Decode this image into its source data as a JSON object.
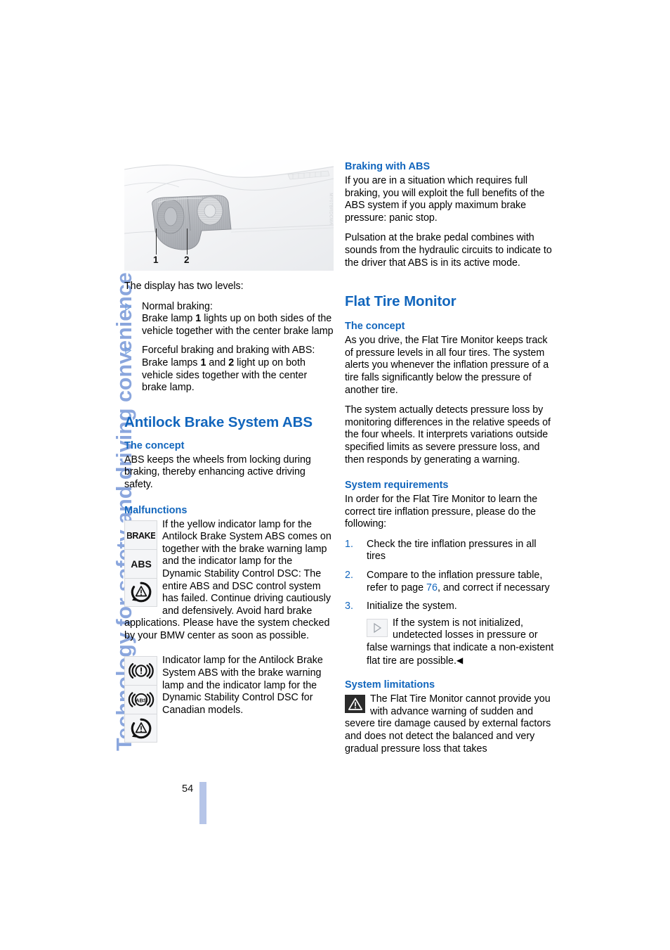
{
  "chapter": {
    "vertical_title": "Technology for safety and driving convenience"
  },
  "footer": {
    "page_number": "54"
  },
  "figure": {
    "caption_labels": [
      "1",
      "2"
    ],
    "watermark": "MY07BRDCMA"
  },
  "left_column": {
    "intro": "The display has two levels:",
    "bullets": [
      {
        "line1": "Normal braking:",
        "line2_pre": "Brake lamp ",
        "line2_bold": "1",
        "line2_post": " lights up on both sides of the vehicle together with the center brake lamp"
      },
      {
        "line1": "Forceful braking and braking with ABS:",
        "line2_pre": "Brake lamps ",
        "line2_bold": "1",
        "line2_mid": " and ",
        "line2_bold2": "2",
        "line2_post": " light up on both vehicle sides together with the center brake lamp."
      }
    ],
    "heading_abs": "Antilock Brake System ABS",
    "concept_heading": "The concept",
    "concept_text": "ABS keeps the wheels from locking during braking, thereby enhancing active driving safety.",
    "malfunctions_heading": "Malfunctions",
    "malfunctions_text": "If the yellow indicator lamp for the Antilock Brake System ABS comes on together with the brake warning lamp and the indicator lamp for the Dynamic Stability Control DSC: The entire ABS and DSC control system has failed. Continue driving cautiously and defensively. Avoid hard brake applications. Please have the system checked by your BMW center as soon as possible.",
    "malfunction_icons": [
      "brake-text-icon",
      "abs-text-icon",
      "dsc-triangle-icon"
    ],
    "canadian_text": "Indicator lamp for the Antilock Brake System ABS with the brake warning lamp and the indicator lamp for the Dynamic Stability Control DSC for Canadian models.",
    "canadian_icons": [
      "brake-circle-exclamation-icon",
      "abs-circle-icon",
      "dsc-triangle-icon"
    ]
  },
  "right_column": {
    "braking_heading": "Braking with ABS",
    "braking_p1": "If you are in a situation which requires full braking, you will exploit the full benefits of the ABS system if you apply maximum brake pressure: panic stop.",
    "braking_p2": "Pulsation at the brake pedal combines with sounds from the hydraulic circuits to indicate to the driver that ABS is in its active mode.",
    "flat_tire_heading": "Flat Tire Monitor",
    "concept_heading": "The concept",
    "concept_p1": "As you drive, the Flat Tire Monitor keeps track of pressure levels in all four tires. The system alerts you whenever the inflation pressure of a tire falls significantly below the pressure of another tire.",
    "concept_p2": "The system actually detects pressure loss by monitoring differences in the relative speeds of the four wheels. It interprets variations outside specified limits as severe pressure loss, and then responds by generating a warning.",
    "requirements_heading": "System requirements",
    "requirements_intro": "In order for the Flat Tire Monitor to learn the correct tire inflation pressure, please do the following:",
    "steps": [
      {
        "num": "1.",
        "text": "Check the tire inflation pressures in all tires"
      },
      {
        "num": "2.",
        "pre": "Compare to the inflation pressure table, refer to page ",
        "ref": "76",
        "post": ", and correct if necessary"
      },
      {
        "num": "3.",
        "text": "Initialize the system."
      }
    ],
    "note_text": "If the system is not initialized, undetected losses in pressure or false warnings that indicate a non-existent flat tire are possible.",
    "note_endmark": "◀",
    "note_icon": "note-triangle-icon",
    "limitations_heading": "System limitations",
    "limitations_text": "The Flat Tire Monitor cannot provide you with advance warning of sudden and severe tire damage caused by external factors and does not detect the balanced and very gradual pressure loss that takes",
    "limitations_icon": "warning-triangle-icon"
  },
  "colors": {
    "heading_blue": "#1266bd",
    "chapter_blue": "#8aa6dd",
    "folio_bar": "#b6c5e8"
  }
}
